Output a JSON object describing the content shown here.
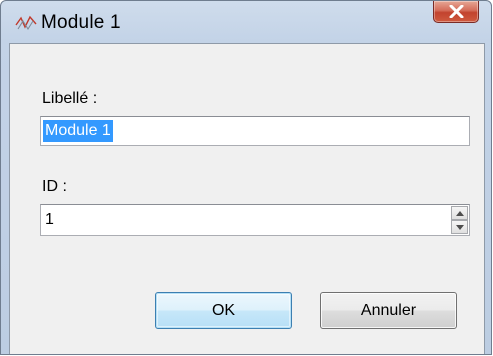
{
  "window": {
    "title": "Module 1",
    "icon": "module-node-icon",
    "close_icon": "close-x-icon"
  },
  "form": {
    "libelle_label": "Libellé :",
    "libelle_value": "Module 1",
    "id_label": "ID :",
    "id_value": "1"
  },
  "buttons": {
    "ok_label": "OK",
    "cancel_label": "Annuler"
  },
  "colors": {
    "close_button": "#c94a35",
    "selection": "#3399ff",
    "default_button_border": "#3c7fb1"
  }
}
